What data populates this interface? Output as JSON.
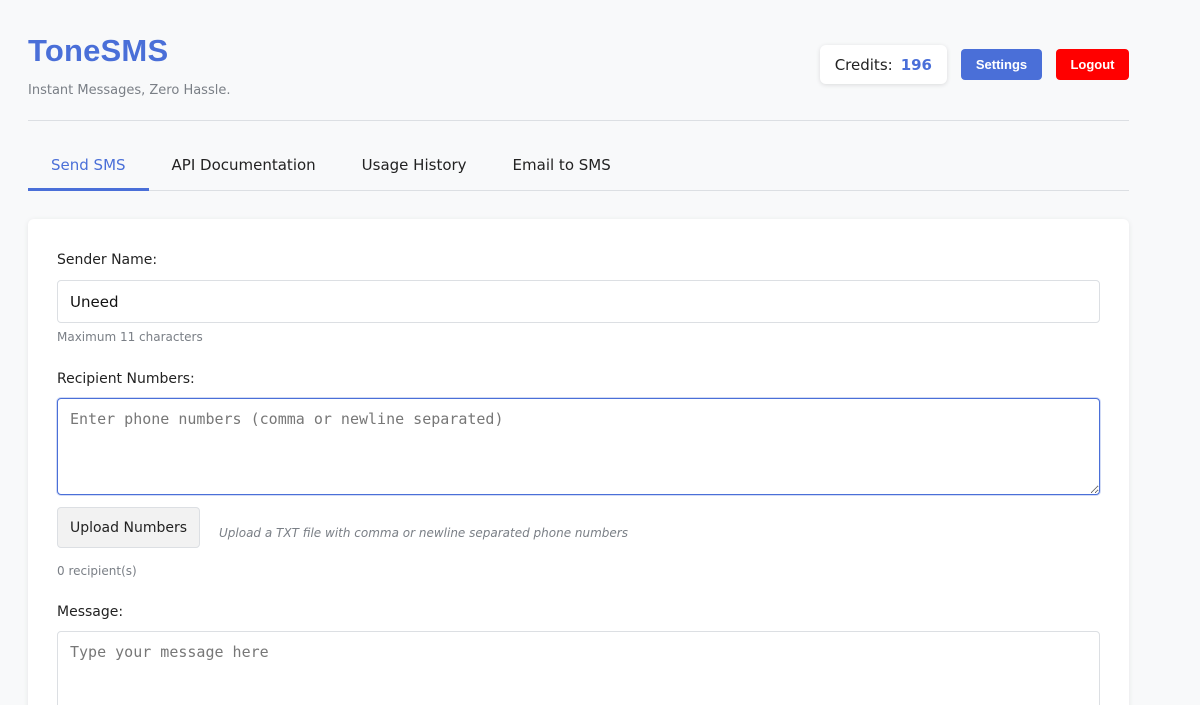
{
  "header": {
    "title": "ToneSMS",
    "tagline": "Instant Messages, Zero Hassle.",
    "credits_label": "Credits:",
    "credits_value": "196",
    "settings_label": "Settings",
    "logout_label": "Logout"
  },
  "tabs": [
    {
      "label": "Send SMS",
      "active": true
    },
    {
      "label": "API Documentation",
      "active": false
    },
    {
      "label": "Usage History",
      "active": false
    },
    {
      "label": "Email to SMS",
      "active": false
    }
  ],
  "form": {
    "sender_label": "Sender Name:",
    "sender_value": "Uneed",
    "sender_hint": "Maximum 11 characters",
    "recipients_label": "Recipient Numbers:",
    "recipients_placeholder": "Enter phone numbers (comma or newline separated)",
    "upload_label": "Upload Numbers",
    "upload_hint": "Upload a TXT file with comma or newline separated phone numbers",
    "recipient_count": "0 recipient(s)",
    "message_label": "Message:",
    "message_placeholder": "Type your message here"
  },
  "colors": {
    "accent": "#4a6fd8",
    "danger": "#ff0000",
    "background": "#f8f9fa"
  }
}
